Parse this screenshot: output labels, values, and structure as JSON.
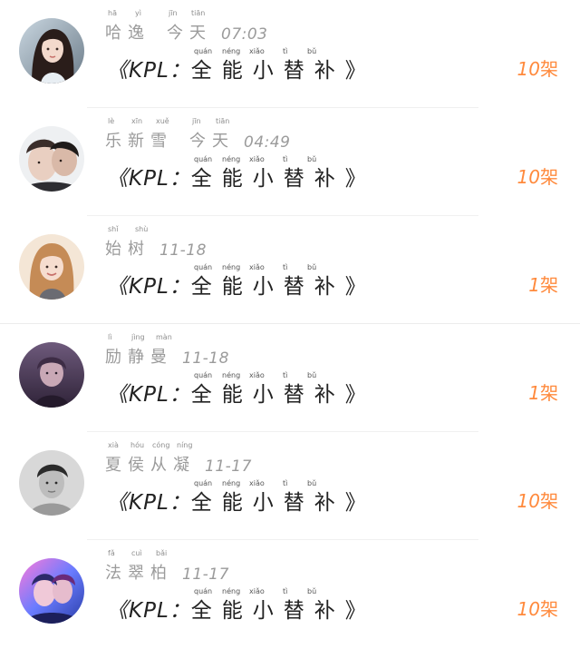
{
  "title_pinyin": [
    "quán",
    "néng",
    "xiǎo",
    "tì",
    "bǔ"
  ],
  "items": [
    {
      "name": "哈逸",
      "name_pinyin": [
        "hā",
        "yì"
      ],
      "date": "今天",
      "date_pinyin": [
        "jīn",
        "tiān"
      ],
      "time": "07:03",
      "title_prefix": "《KPL：",
      "title_cjk": "全能小替补",
      "title_suffix": "》",
      "count_num": "10",
      "count_unit": "架",
      "avatar_icon": "avatar-girl-long-hair-icon"
    },
    {
      "name": "乐新雪",
      "name_pinyin": [
        "lè",
        "xīn",
        "xuě"
      ],
      "date": "今天",
      "date_pinyin": [
        "jīn",
        "tiān"
      ],
      "time": "04:49",
      "title_prefix": "《KPL：",
      "title_cjk": "全能小替补",
      "title_suffix": "》",
      "count_num": "10",
      "count_unit": "架",
      "avatar_icon": "avatar-two-people-icon"
    },
    {
      "name": "始树",
      "name_pinyin": [
        "shǐ",
        "shù"
      ],
      "date": "",
      "date_pinyin": [],
      "time": "11-18",
      "title_prefix": "《KPL：",
      "title_cjk": "全能小替补",
      "title_suffix": "》",
      "count_num": "1",
      "count_unit": "架",
      "avatar_icon": "avatar-girl-smile-icon"
    },
    {
      "name": "励静曼",
      "name_pinyin": [
        "lì",
        "jìng",
        "màn"
      ],
      "date": "",
      "date_pinyin": [],
      "time": "11-18",
      "title_prefix": "《KPL：",
      "title_cjk": "全能小替补",
      "title_suffix": "》",
      "count_num": "1",
      "count_unit": "架",
      "avatar_icon": "avatar-purple-portrait-icon"
    },
    {
      "name": "夏侯从凝",
      "name_pinyin": [
        "xià",
        "hóu",
        "cóng",
        "níng"
      ],
      "date": "",
      "date_pinyin": [],
      "time": "11-17",
      "title_prefix": "《KPL：",
      "title_cjk": "全能小替补",
      "title_suffix": "》",
      "count_num": "10",
      "count_unit": "架",
      "avatar_icon": "avatar-boy-grayscale-icon"
    },
    {
      "name": "法翠柏",
      "name_pinyin": [
        "fǎ",
        "cuì",
        "bǎi"
      ],
      "date": "",
      "date_pinyin": [],
      "time": "11-17",
      "title_prefix": "《KPL：",
      "title_cjk": "全能小替补",
      "title_suffix": "》",
      "count_num": "10",
      "count_unit": "架",
      "avatar_icon": "avatar-neon-portrait-icon"
    }
  ],
  "colors": {
    "accent": "#ff8a3d",
    "meta_text": "#9b9b9b",
    "title_text": "#222222"
  }
}
